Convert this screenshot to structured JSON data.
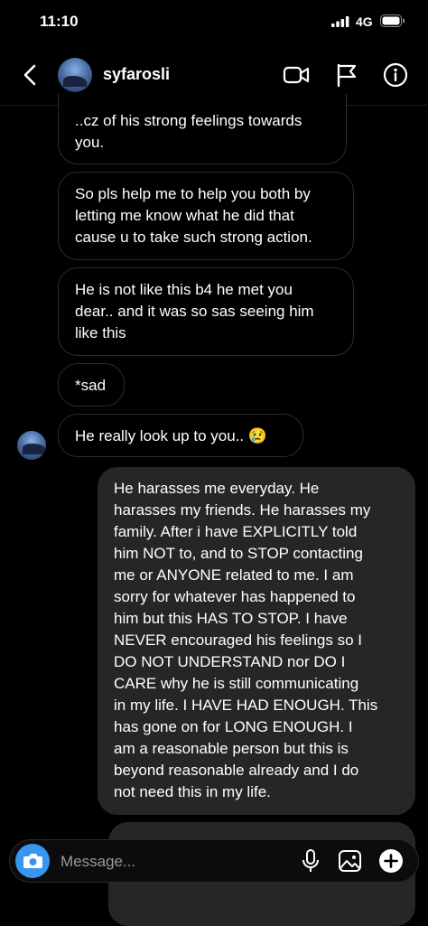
{
  "status_bar": {
    "time": "11:10",
    "network": "4G"
  },
  "header": {
    "username": "syfarosli"
  },
  "messages": [
    {
      "from": "them",
      "lines": [
        "..cz of his strong feelings towards",
        "you."
      ]
    },
    {
      "from": "them",
      "lines": [
        "So pls help me to help you both by",
        "letting me know what he did that",
        "cause u to take such strong action."
      ]
    },
    {
      "from": "them",
      "lines": [
        "He is not like this b4 he met you",
        "dear.. and it was so sas seeing him",
        "like this"
      ]
    },
    {
      "from": "them",
      "lines": [
        "*sad"
      ]
    },
    {
      "from": "them",
      "lines": [
        "He really look up to you.. 😢"
      ]
    },
    {
      "from": "me",
      "lines": [
        "He harasses me everyday. He",
        "harasses my friends. He harasses my",
        "family. After i have EXPLICITLY told",
        "him NOT to, and to STOP contacting",
        "me or ANYONE related to me. I am",
        "sorry for whatever has happened to",
        "him but this HAS TO STOP.  I have",
        "NEVER encouraged his feelings so I",
        "DO NOT UNDERSTAND nor DO I",
        "CARE why he is still communicating",
        "in my life. I HAVE HAD ENOUGH. This",
        "has gone on for LONG ENOUGH. I",
        "am a reasonable person but this is",
        "beyond reasonable already and I do",
        "not need this in my life."
      ]
    }
  ],
  "composer": {
    "placeholder": "Message..."
  },
  "colors": {
    "sent_bubble": "#262626",
    "received_border": "#2e2e2e",
    "camera_button": "#3797f0",
    "background": "#000000"
  },
  "icons": [
    "back-icon",
    "video-call-icon",
    "flag-icon",
    "info-icon",
    "camera-icon",
    "microphone-icon",
    "gallery-icon",
    "add-icon"
  ]
}
